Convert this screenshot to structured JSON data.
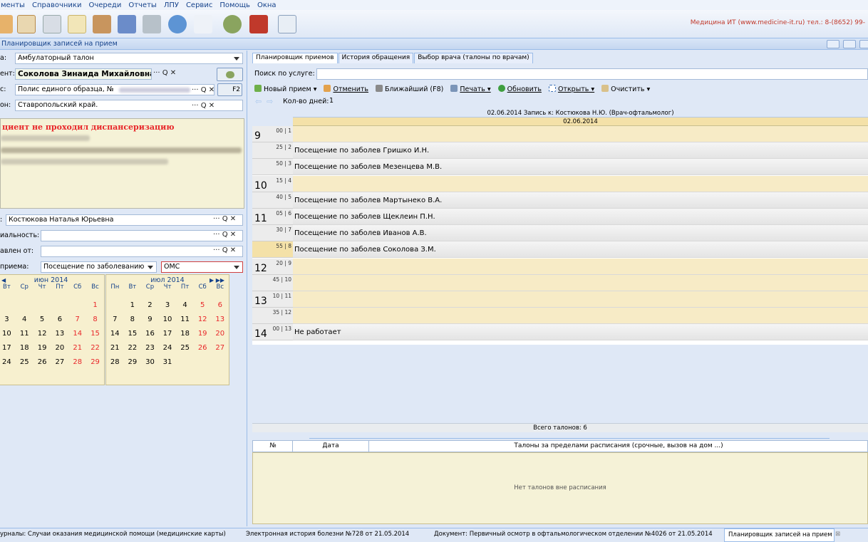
{
  "menu": [
    "менты",
    "Справочники",
    "Очереди",
    "Отчеты",
    "ЛПУ",
    "Сервис",
    "Помощь",
    "Окна"
  ],
  "company": "Медицина ИТ (www.medicine-it.ru) тел.: 8-(8652) 99-",
  "window_title": "Планировщик записей на прием",
  "left": {
    "form_label": "а:",
    "form_value": "Амбулаторный талон",
    "patient_label": "ент:",
    "patient_value": "Соколова Зинаида Михайловна",
    "policy_label": "с:",
    "policy_value": "Полис единого образца, №",
    "region_label": "он:",
    "region_value": "Ставропольский край.",
    "f2_label": "F2",
    "warning": "циент не проходил диспансеризацию",
    "doctor_label": ":",
    "doctor_value": "Костюкова Наталья Юрьевна",
    "specialty_label": "иальность:",
    "sent_label": "авлен от:",
    "visit_type_label": "приема:",
    "visit_type_value": "Посещение по заболеванию",
    "payment_value": "ОМС",
    "lookup_glyphs": "··· Q ✕"
  },
  "calendar_june": {
    "title": "июн 2014",
    "dow": [
      "Вт",
      "Ср",
      "Чт",
      "Пт",
      "Сб",
      "Вс"
    ],
    "rows": [
      [
        "",
        "",
        "",
        "",
        "",
        "1"
      ],
      [
        "3",
        "4",
        "5",
        "6",
        "7",
        "8"
      ],
      [
        "10",
        "11",
        "12",
        "13",
        "14",
        "15"
      ],
      [
        "17",
        "18",
        "19",
        "20",
        "21",
        "22"
      ],
      [
        "24",
        "25",
        "26",
        "27",
        "28",
        "29"
      ]
    ]
  },
  "calendar_july": {
    "title": "июл 2014",
    "dow": [
      "Пн",
      "Вт",
      "Ср",
      "Чт",
      "Пт",
      "Сб",
      "Вс"
    ],
    "rows": [
      [
        "",
        "1",
        "2",
        "3",
        "4",
        "5",
        "6"
      ],
      [
        "7",
        "8",
        "9",
        "10",
        "11",
        "12",
        "13"
      ],
      [
        "14",
        "15",
        "16",
        "17",
        "18",
        "19",
        "20"
      ],
      [
        "21",
        "22",
        "23",
        "24",
        "25",
        "26",
        "27"
      ],
      [
        "28",
        "29",
        "30",
        "31",
        "",
        "",
        ""
      ]
    ]
  },
  "tabs": [
    "Планировщик приемов",
    "История обращения",
    "Выбор врача (талоны по врачам)"
  ],
  "service_search_label": "Поиск по услуге:",
  "actions": [
    "Новый прием ▾",
    "Отменить",
    "Ближайший (F8)",
    "Печать ▾",
    "Обновить",
    "Открыть ▾",
    "Очистить ▾"
  ],
  "days_label": "Кол-во дней:",
  "days_value": "1",
  "schedule": {
    "header": "02.06.2014 Запись к: Костюкова Н.Ю. (Врач-офтальмолог)",
    "date": "02.06.2014",
    "slots": [
      {
        "hour": "9",
        "min": "00 |  1",
        "text": "",
        "busy": false
      },
      {
        "hour": "",
        "min": "25 |  2",
        "text": "Посещение по заболев Гришко И.Н.",
        "busy": true
      },
      {
        "hour": "",
        "min": "50 |  3",
        "text": "Посещение по заболев Мезенцева М.В.",
        "busy": true
      },
      {
        "hour": "10",
        "min": "15 |  4",
        "text": "",
        "busy": false
      },
      {
        "hour": "",
        "min": "40 |  5",
        "text": "Посещение по заболев Мартынеко В.А.",
        "busy": true
      },
      {
        "hour": "11",
        "min": "05 |  6",
        "text": "Посещение по заболев Щеклеин П.Н.",
        "busy": true
      },
      {
        "hour": "",
        "min": "30 |  7",
        "text": "Посещение по заболев Иванов А.В.",
        "busy": true
      },
      {
        "hour": "",
        "min": "55 |  8",
        "text": "Посещение по заболев Соколова З.М.",
        "busy": true
      },
      {
        "hour": "12",
        "min": "20 |  9",
        "text": "",
        "busy": false
      },
      {
        "hour": "",
        "min": "45 | 10",
        "text": "",
        "busy": false
      },
      {
        "hour": "13",
        "min": "10 | 11",
        "text": "",
        "busy": false
      },
      {
        "hour": "",
        "min": "35 | 12",
        "text": "",
        "busy": false
      },
      {
        "hour": "14",
        "min": "00 | 13",
        "text": "Не работает",
        "busy": true
      }
    ],
    "total": "Всего талонов: 6"
  },
  "extra": {
    "col_no": "№",
    "col_date": "Дата",
    "col_title": "Талоны за пределами расписания (срочные, вызов на дом ...)",
    "empty": "Нет талонов вне расписания"
  },
  "status": {
    "s1": "урналы: Случаи оказания медицинской помощи (медицинские карты)",
    "s2": "Электронная история болезни №728 от 21.05.2014",
    "s3": "Документ: Первичный осмотр в офтальмологическом отделении №4026 от 21.05.2014",
    "s4": "Планировщик записей на прием"
  },
  "colors": {
    "accent": "#15428b",
    "warning": "#e8272a",
    "free_slot": "#f7ebc6",
    "panel": "#dfe8f6"
  }
}
